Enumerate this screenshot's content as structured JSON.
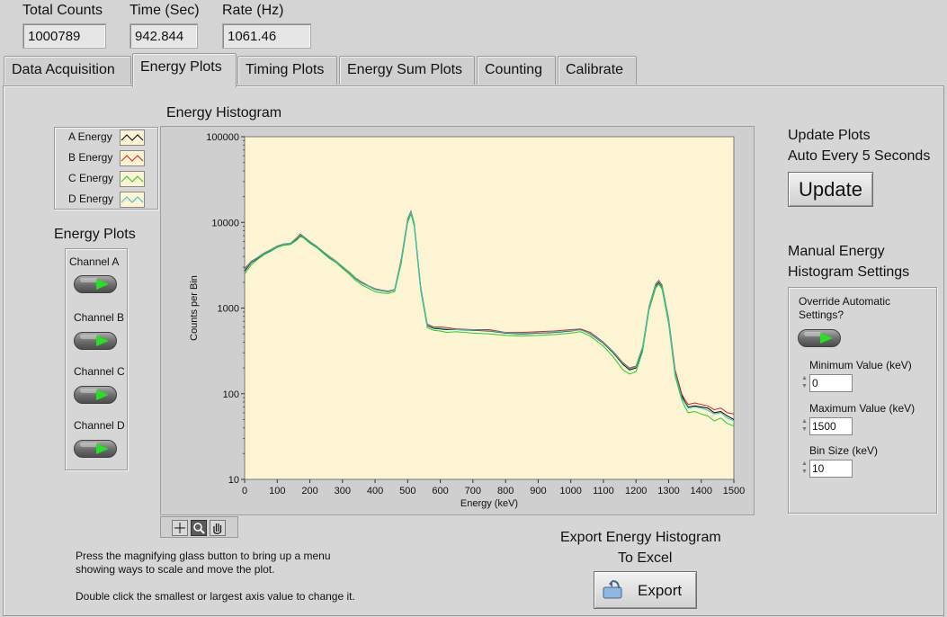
{
  "indicators": [
    {
      "label": "Total Counts",
      "value": "1000789"
    },
    {
      "label": "Time (Sec)",
      "value": "942.844"
    },
    {
      "label": "Rate (Hz)",
      "value": "1061.46"
    }
  ],
  "tabs": [
    "Data Acquisition",
    "Energy Plots",
    "Timing Plots",
    "Energy Sum Plots",
    "Counting",
    "Calibrate"
  ],
  "active_tab": "Energy Plots",
  "legend": [
    {
      "label": "A Energy",
      "color": "#000000"
    },
    {
      "label": "B Energy",
      "color": "#e02020"
    },
    {
      "label": "C Energy",
      "color": "#22d022"
    },
    {
      "label": "D Energy",
      "color": "#29c6d6"
    }
  ],
  "channels": {
    "title": "Energy Plots",
    "items": [
      {
        "label": "Channel A",
        "on": true
      },
      {
        "label": "Channel B",
        "on": true
      },
      {
        "label": "Channel C",
        "on": true
      },
      {
        "label": "Channel D",
        "on": true
      }
    ]
  },
  "plot_title": "Energy Histogram",
  "help_text": {
    "line1": "Press the magnifying glass button to bring up a menu",
    "line2": "showing ways to scale and move the plot.",
    "line3": "Double click the smallest or largest axis value to change it."
  },
  "update": {
    "line1": "Update Plots",
    "line2": "Auto Every 5 Seconds",
    "button": "Update"
  },
  "manual": {
    "line1": "Manual Energy",
    "line2": "Histogram Settings",
    "override_line1": "Override Automatic",
    "override_line2": "Settings?",
    "fields": [
      {
        "label": "Minimum Value (keV)",
        "value": "0"
      },
      {
        "label": "Maximum Value (keV)",
        "value": "1500"
      },
      {
        "label": "Bin Size (keV)",
        "value": "10"
      }
    ]
  },
  "export": {
    "line1": "Export Energy Histogram",
    "line2": "To Excel",
    "button": "Export"
  },
  "chart_data": {
    "type": "line",
    "title": "Energy Histogram",
    "xlabel": "Energy (keV)",
    "ylabel": "Counts per Bin",
    "xlim": [
      0,
      1500
    ],
    "ylim": [
      10,
      100000
    ],
    "yscale": "log",
    "grid": false,
    "legend": "top-left",
    "background": "#fcf4d2",
    "x_ticks": [
      0,
      100,
      200,
      300,
      400,
      500,
      600,
      700,
      800,
      900,
      1000,
      1100,
      1200,
      1300,
      1400,
      1500
    ],
    "y_ticks": [
      10,
      100,
      1000,
      10000,
      100000
    ],
    "y_tick_labels": [
      "10",
      "100",
      "1000",
      "10000",
      "100000"
    ],
    "x": [
      0,
      20,
      40,
      60,
      80,
      100,
      120,
      140,
      160,
      170,
      180,
      200,
      220,
      240,
      260,
      280,
      300,
      320,
      340,
      360,
      380,
      400,
      420,
      440,
      460,
      480,
      500,
      510,
      520,
      540,
      560,
      580,
      600,
      620,
      650,
      700,
      750,
      800,
      850,
      900,
      950,
      1000,
      1030,
      1060,
      1100,
      1130,
      1160,
      1180,
      1200,
      1220,
      1240,
      1260,
      1270,
      1280,
      1300,
      1320,
      1340,
      1350,
      1360,
      1380,
      1400,
      1420,
      1440,
      1460,
      1480,
      1500
    ],
    "series": [
      {
        "name": "A Energy",
        "values": [
          2700,
          3400,
          3800,
          4300,
          4700,
          5200,
          5500,
          5600,
          6400,
          7000,
          6800,
          5900,
          5200,
          4500,
          3900,
          3500,
          3000,
          2600,
          2200,
          1950,
          1800,
          1650,
          1600,
          1550,
          1620,
          3500,
          10500,
          13000,
          9500,
          1700,
          620,
          580,
          570,
          560,
          560,
          550,
          540,
          510,
          500,
          510,
          520,
          540,
          560,
          500,
          390,
          300,
          220,
          190,
          200,
          330,
          1000,
          1800,
          2000,
          1750,
          700,
          180,
          95,
          80,
          70,
          72,
          70,
          68,
          60,
          62,
          55,
          50
        ]
      },
      {
        "name": "B Energy",
        "values": [
          2900,
          3500,
          3900,
          4400,
          4800,
          5300,
          5600,
          5700,
          6600,
          7300,
          6900,
          6000,
          5300,
          4600,
          4000,
          3550,
          3050,
          2650,
          2250,
          2000,
          1820,
          1680,
          1620,
          1580,
          1650,
          3700,
          11000,
          13500,
          9800,
          1750,
          650,
          600,
          600,
          590,
          570,
          560,
          560,
          520,
          520,
          530,
          540,
          560,
          570,
          520,
          400,
          310,
          230,
          200,
          210,
          350,
          1050,
          1900,
          2100,
          1850,
          750,
          190,
          100,
          85,
          75,
          78,
          75,
          72,
          65,
          68,
          60,
          58
        ]
      },
      {
        "name": "C Energy",
        "values": [
          2500,
          3200,
          3700,
          4200,
          4600,
          5100,
          5400,
          5500,
          6200,
          6800,
          6600,
          5700,
          5100,
          4400,
          3800,
          3400,
          2900,
          2500,
          2100,
          1850,
          1700,
          1550,
          1500,
          1480,
          1550,
          3300,
          10000,
          12500,
          9000,
          1600,
          590,
          550,
          540,
          520,
          530,
          510,
          500,
          480,
          470,
          480,
          490,
          510,
          530,
          470,
          360,
          270,
          190,
          170,
          180,
          310,
          950,
          1700,
          1900,
          1650,
          650,
          160,
          85,
          70,
          60,
          62,
          58,
          55,
          48,
          52,
          45,
          42
        ]
      },
      {
        "name": "D Energy",
        "values": [
          2800,
          3450,
          3850,
          4350,
          4750,
          5250,
          5550,
          5650,
          6500,
          7100,
          6850,
          5950,
          5250,
          4550,
          3950,
          3500,
          3020,
          2620,
          2220,
          1960,
          1810,
          1660,
          1610,
          1560,
          1630,
          3550,
          10600,
          13200,
          9600,
          1720,
          630,
          590,
          580,
          570,
          560,
          555,
          545,
          515,
          505,
          515,
          525,
          545,
          555,
          505,
          395,
          305,
          225,
          195,
          205,
          340,
          1020,
          1850,
          2050,
          1780,
          720,
          175,
          90,
          78,
          68,
          70,
          68,
          64,
          58,
          60,
          52,
          48
        ]
      }
    ]
  }
}
